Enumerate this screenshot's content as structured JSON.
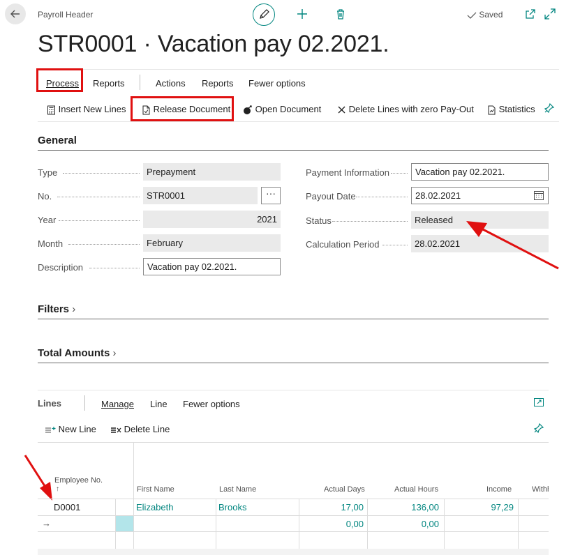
{
  "header": {
    "caption": "Payroll Header",
    "title": "STR0001 · Vacation pay 02.2021.",
    "saved_label": "Saved"
  },
  "action_tabs": [
    {
      "label": "Process"
    },
    {
      "label": "Reports"
    },
    {
      "label": "Actions"
    },
    {
      "label": "Reports"
    },
    {
      "label": "Fewer options"
    }
  ],
  "actions": [
    {
      "label": "Insert New Lines"
    },
    {
      "label": "Release Document"
    },
    {
      "label": "Open Document"
    },
    {
      "label": "Delete Lines with zero Pay-Out"
    },
    {
      "label": "Statistics"
    }
  ],
  "general": {
    "title": "General",
    "left": [
      {
        "label": "Type",
        "value": "Prepayment"
      },
      {
        "label": "No.",
        "value": "STR0001"
      },
      {
        "label": "Year",
        "value": "2021"
      },
      {
        "label": "Month",
        "value": "February"
      },
      {
        "label": "Description",
        "value": "Vacation pay 02.2021."
      }
    ],
    "right": [
      {
        "label": "Payment Information",
        "value": "Vacation pay 02.2021."
      },
      {
        "label": "Payout Date",
        "value": "28.02.2021"
      },
      {
        "label": "Status",
        "value": "Released"
      },
      {
        "label": "Calculation Period",
        "value": "28.02.2021"
      }
    ]
  },
  "sections": {
    "filters": "Filters",
    "total_amounts": "Total Amounts"
  },
  "lines": {
    "title": "Lines",
    "tabs": [
      {
        "label": "Manage"
      },
      {
        "label": "Line"
      },
      {
        "label": "Fewer options"
      }
    ],
    "new_line": "New Line",
    "delete_line": "Delete Line",
    "columns": [
      {
        "label": "Employee No."
      },
      {
        "label": "First Name"
      },
      {
        "label": "Last Name"
      },
      {
        "label": "Actual Days"
      },
      {
        "label": "Actual Hours"
      },
      {
        "label": "Income"
      },
      {
        "label": "Withh"
      }
    ],
    "sort_indicator": "↑",
    "rows": [
      {
        "employee_no": "D0001",
        "first_name": "Elizabeth",
        "last_name": "Brooks",
        "actual_days": "17,00",
        "actual_hours": "136,00",
        "income": "97,29"
      },
      {
        "employee_no": "",
        "first_name": "",
        "last_name": "",
        "actual_days": "0,00",
        "actual_hours": "0,00",
        "income": ""
      }
    ],
    "new_row_marker": "→"
  },
  "colors": {
    "accent": "#00857f",
    "highlight": "#e01010",
    "readonly_field": "#eaeaea",
    "selected_cell": "#b3e5ea"
  }
}
